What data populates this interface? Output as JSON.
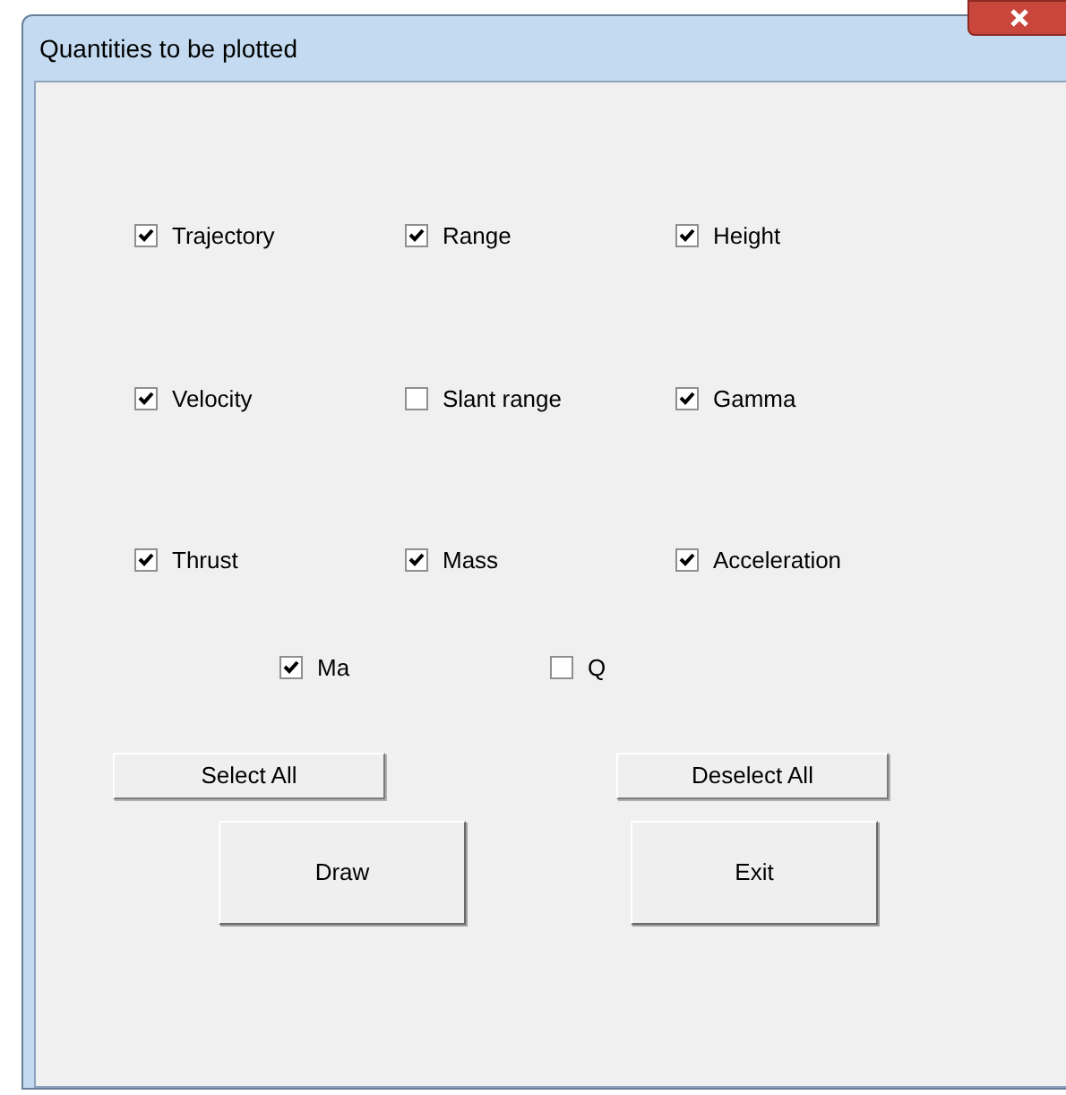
{
  "window": {
    "title": "Quantities to be plotted"
  },
  "option_rows": [
    [
      {
        "label": "Trajectory",
        "checked": true
      },
      {
        "label": "Range",
        "checked": true
      },
      {
        "label": "Height",
        "checked": true
      }
    ],
    [
      {
        "label": "Velocity",
        "checked": true
      },
      {
        "label": "Slant range",
        "checked": false
      },
      {
        "label": "Gamma",
        "checked": true
      }
    ],
    [
      {
        "label": "Thrust",
        "checked": true
      },
      {
        "label": "Mass",
        "checked": true
      },
      {
        "label": "Acceleration",
        "checked": true
      }
    ],
    [
      {
        "label": "Ma",
        "checked": true
      },
      {
        "label": "Q",
        "checked": false
      }
    ]
  ],
  "selection_buttons": [
    "Select All",
    "Deselect All"
  ],
  "action_buttons": [
    "Draw",
    "Exit"
  ]
}
